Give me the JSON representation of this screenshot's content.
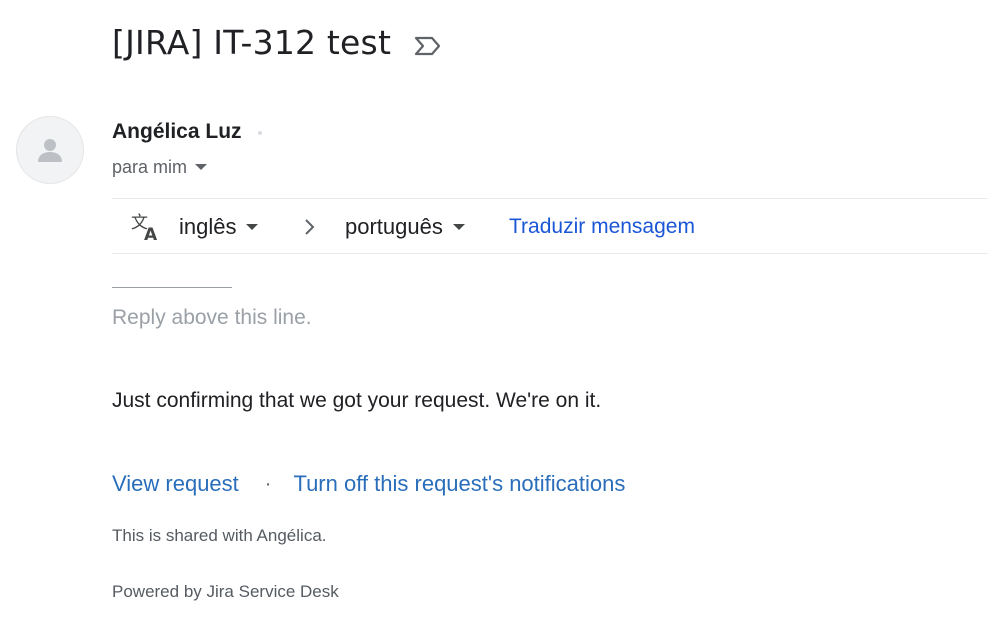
{
  "email": {
    "subject": "[JIRA] IT-312 test",
    "label_icon": "label-arrow-icon"
  },
  "sender": {
    "name": "Angélica Luz",
    "recipient_label": "para mim",
    "avatar_icon": "person-icon"
  },
  "translate_bar": {
    "icon": "translate-icon",
    "from_language": "inglês",
    "to_language": "português",
    "translate_link": "Traduzir mensagem",
    "link_color": "#1a57d6"
  },
  "body": {
    "separator": "————————",
    "reply_above": "Reply above this line.",
    "message": "Just confirming that we got your request. We're on it.",
    "view_request_link": "View request",
    "separator_dot": "·",
    "turn_off_link": "Turn off this request's notifications",
    "shared_note": "This is shared with Angélica.",
    "powered_by": "Powered by Jira Service Desk",
    "link_color": "#2a6ebb"
  }
}
